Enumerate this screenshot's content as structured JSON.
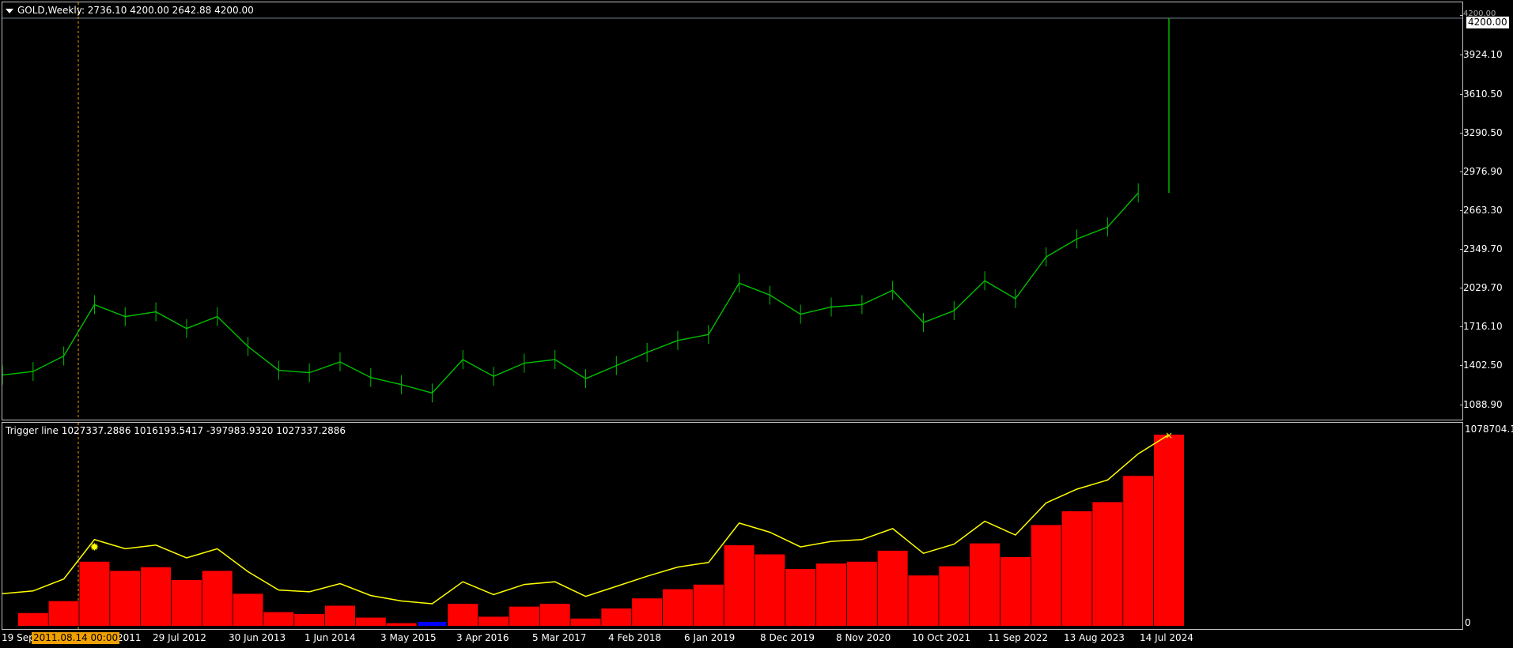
{
  "price_pane": {
    "title": "GOLD,Weekly",
    "ohlc": "2736.10 4200.00 2642.88 4200.00",
    "last_price": "4200.00",
    "y_ticks": [
      "4200.00",
      "3924.10",
      "3610.50",
      "3290.50",
      "2976.90",
      "2663.30",
      "2349.70",
      "2029.70",
      "1716.10",
      "1402.50",
      "1088.90"
    ],
    "y_range": [
      870,
      4200
    ],
    "colors": {
      "candles": "#00c000",
      "grid_line": "#708090",
      "crosshair": "#f0a000"
    }
  },
  "indicator_pane": {
    "title": "Trigger line",
    "values": "1027337.2886 1016193.5417 -397983.9320 1027337.2886",
    "max_label": "1078704.1",
    "zero_label": "0",
    "colors": {
      "histogram_up": "#ff0000",
      "histogram_down": "#0000ff",
      "trigger": "#ffff00"
    }
  },
  "x_axis": {
    "labels": [
      "19 Sep",
      "2011",
      "29 Jul 2012",
      "30 Jun 2013",
      "1 Jun 2014",
      "3 May 2015",
      "3 Apr 2016",
      "5 Mar 2017",
      "4 Feb 2018",
      "6 Jan 2019",
      "8 Dec 2019",
      "8 Nov 2020",
      "10 Oct 2021",
      "11 Sep 2022",
      "13 Aug 2023",
      "14 Jul 2024"
    ],
    "crosshair_date": "2011.08.14 00:00"
  },
  "chart_data": {
    "type": "line",
    "series": [
      {
        "dates": [
          "2009.12",
          "2010.06",
          "2011.01",
          "2011.08",
          "2011.09",
          "2012.02",
          "2012.07",
          "2012.12",
          "2013.04",
          "2013.07",
          "2013.12",
          "2014.06",
          "2014.12",
          "2015.07",
          "2015.12",
          "2016.07",
          "2017.01",
          "2017.09",
          "2018.04",
          "2018.08",
          "2019.01",
          "2019.06",
          "2019.09",
          "2020.03",
          "2020.08",
          "2020.12",
          "2021.03",
          "2021.06",
          "2021.12",
          "2022.03",
          "2022.09",
          "2022.11",
          "2023.05",
          "2023.10",
          "2024.03",
          "2024.05",
          "2024.07",
          "2024.10",
          "2024.11"
        ],
        "close": [
          1210,
          1240,
          1370,
          1800,
          1700,
          1740,
          1600,
          1700,
          1450,
          1250,
          1230,
          1320,
          1190,
          1130,
          1060,
          1340,
          1200,
          1310,
          1340,
          1180,
          1290,
          1400,
          1500,
          1550,
          1980,
          1880,
          1720,
          1780,
          1800,
          1920,
          1650,
          1750,
          2000,
          1850,
          2200,
          2350,
          2450,
          2736,
          4200
        ]
      }
    ]
  }
}
